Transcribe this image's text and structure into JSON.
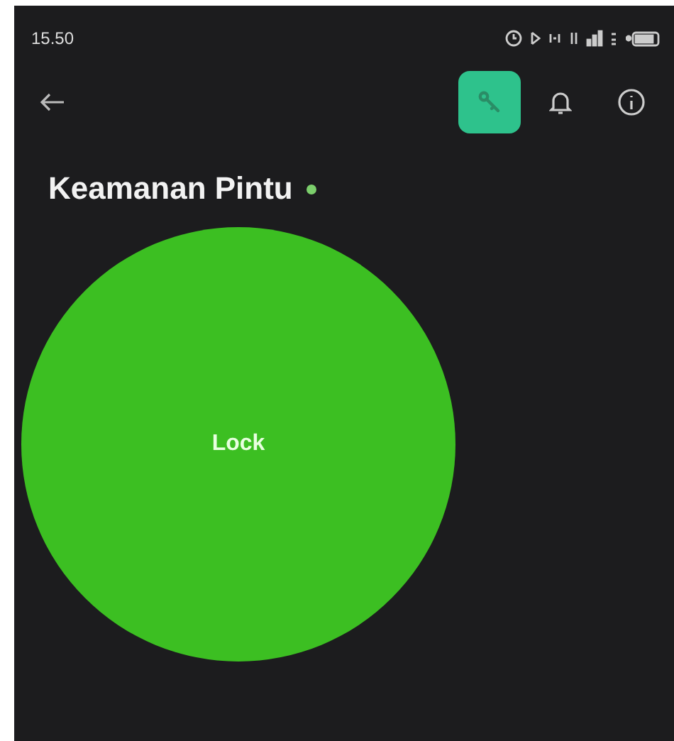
{
  "status_bar": {
    "time": "15.50"
  },
  "app_bar": {
    "actions": [
      {
        "kind": "key",
        "selected": true
      },
      {
        "kind": "bell",
        "selected": false
      },
      {
        "kind": "info",
        "selected": false
      }
    ]
  },
  "title": "Keamanan Pintu",
  "online": true,
  "lock_button": {
    "label": "Lock"
  }
}
